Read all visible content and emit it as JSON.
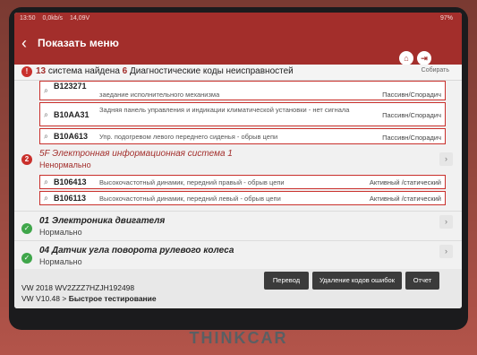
{
  "device": {
    "brand": "THINKCAR"
  },
  "status_bar": {
    "time": "13:50",
    "data": "0,0kb/s",
    "voltage": "14,09V",
    "battery": "97%"
  },
  "header": {
    "title": "Показать меню",
    "home_icon": "home-icon",
    "exit_icon": "exit-icon",
    "help_icon": "help-icon"
  },
  "summary": {
    "systems_count": "13",
    "systems_text": "система найдена",
    "codes_count": "6",
    "codes_text": "Диагностические коды неисправностей",
    "collect_label": "Собирать"
  },
  "dtc_partial": {
    "code": "B123271",
    "desc": "заедание исполнительного механизма",
    "state": "Пассивн/Спорадич"
  },
  "dtc_list_1": [
    {
      "code": "B10AA31",
      "desc": "Задняя панель управления и индикации климатической установки - нет сигнала",
      "state": "Пассивн/Спорадич"
    },
    {
      "code": "B10A613",
      "desc": "Упр. подогревом левого переднего сиденья - обрыв цепи",
      "state": "Пассивн/Спорадич"
    }
  ],
  "system_5f": {
    "badge": "2",
    "name": "5F Электронная информационная система 1",
    "status": "Ненормально"
  },
  "dtc_list_2": [
    {
      "code": "B106413",
      "desc": "Высокочастотный динамик, передний правый - обрыв цепи",
      "state": "Активный /статический"
    },
    {
      "code": "B106113",
      "desc": "Высокочастотный динамик, передний левый - обрыв цепи",
      "state": "Активный /статический"
    }
  ],
  "system_01": {
    "name": "01 Электроника двигателя",
    "status": "Нормально"
  },
  "system_04": {
    "name": "04 Датчик угла поворота рулевого колеса",
    "status": "Нормально"
  },
  "footer": {
    "vehicle": "VW 2018  WV2ZZZ7HZJH192498",
    "software_prefix": "VW V10.48 >",
    "software_mode": "Быстрое тестирование"
  },
  "buttons": {
    "translate": "Перевод",
    "clear_codes": "Удаление кодов ошибок",
    "report": "Отчет"
  },
  "colors": {
    "accent": "#a32e2b",
    "error": "#c9302c",
    "ok": "#3fa64a"
  }
}
